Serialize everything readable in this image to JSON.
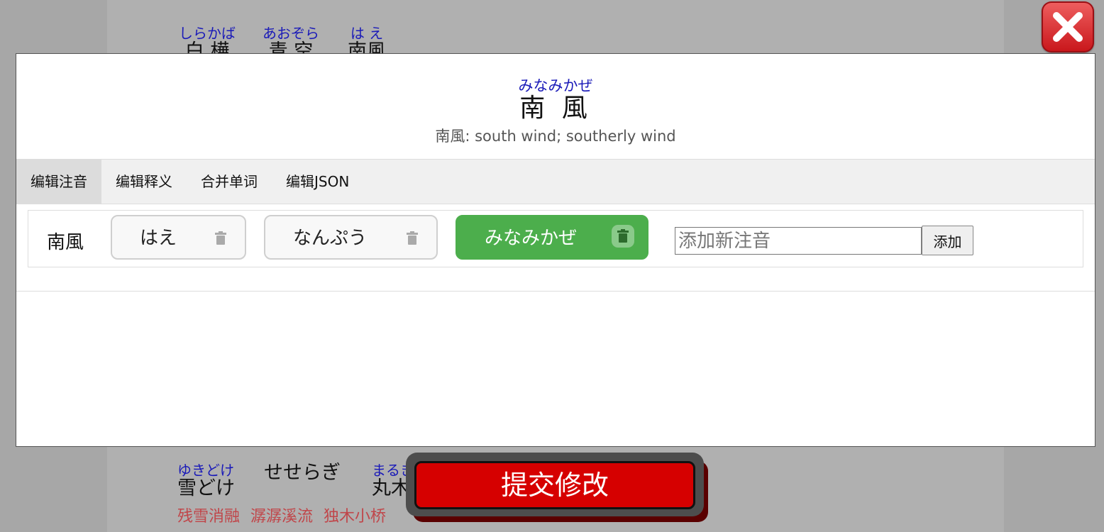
{
  "background": {
    "top_words": [
      {
        "ruby": "しらかば",
        "base": "白 樺"
      },
      {
        "ruby": "あおぞら",
        "base": "青 空"
      },
      {
        "ruby": "は え",
        "base": "南風"
      }
    ],
    "bottom_words": [
      {
        "ruby": "ゆきどけ",
        "base": "雪どけ"
      },
      {
        "ruby": "",
        "base": "せせらぎ"
      },
      {
        "ruby": "まるき",
        "base": "丸木"
      }
    ],
    "bottom_meanings": [
      "残雪消融",
      "潺潺溪流",
      "独木小桥"
    ]
  },
  "close_button": {
    "icon": "close-icon",
    "color": "#d9272e"
  },
  "modal": {
    "word_ruby": "みなみかぜ",
    "word": "南 風",
    "definition": "南風: south wind; southerly wind",
    "tabs": [
      {
        "label": "编辑注音",
        "active": true
      },
      {
        "label": "编辑释义",
        "active": false
      },
      {
        "label": "合并单词",
        "active": false
      },
      {
        "label": "编辑JSON",
        "active": false
      }
    ],
    "editor": {
      "word": "南風",
      "readings": [
        {
          "text": "はえ",
          "selected": false
        },
        {
          "text": "なんぷう",
          "selected": false
        },
        {
          "text": "みなみかぜ",
          "selected": true
        }
      ],
      "new_reading_placeholder": "添加新注音",
      "new_reading_value": "",
      "add_label": "添加"
    }
  },
  "submit": {
    "label": "提交修改",
    "color": "#d60000"
  }
}
